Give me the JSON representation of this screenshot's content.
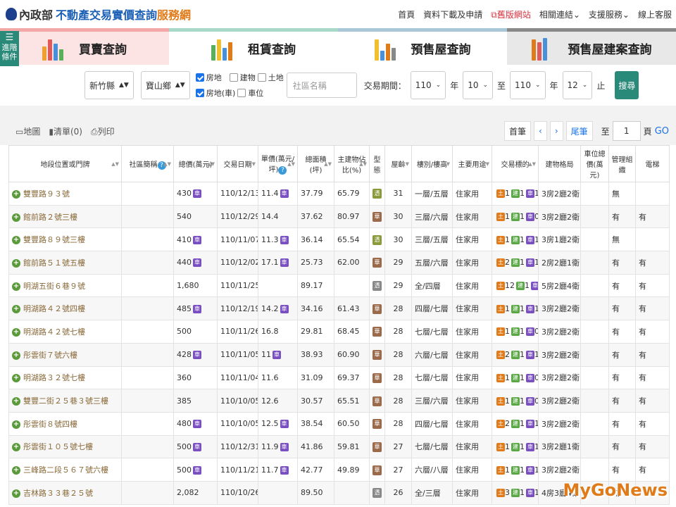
{
  "header": {
    "ministry": "內政部",
    "title_main": "不動產交易實價查詢",
    "title_suffix": "服務網",
    "nav": [
      "首頁",
      "資料下載及申請",
      "舊版網站",
      "相關連結",
      "支援服務",
      "線上客服"
    ]
  },
  "advanced": {
    "label1": "進階",
    "label2": "條件"
  },
  "tabs": [
    {
      "label": "買賣查詢"
    },
    {
      "label": "租賃查詢"
    },
    {
      "label": "預售屋查詢"
    },
    {
      "label": "預售屋建案查詢"
    }
  ],
  "filters": {
    "county": "新竹縣",
    "town": "寶山鄉",
    "types": [
      "房地",
      "建物",
      "土地",
      "房地(車)",
      "車位"
    ],
    "types_checked": [
      true,
      false,
      false,
      true,
      false
    ],
    "community_placeholder": "社區名稱",
    "period_label": "交易期間：",
    "from_year": "110",
    "year_unit": "年",
    "from_month": "10",
    "to_label": "至",
    "to_year": "110",
    "to_month": "12",
    "end_label": "止",
    "search": "搜尋"
  },
  "toolbar": {
    "map": "地圖",
    "list": "清單(0)",
    "print": "列印",
    "first": "首筆",
    "prev": "‹",
    "next": "›",
    "last": "尾筆",
    "to": "至",
    "page": "1",
    "page_unit": "頁",
    "go": "GO"
  },
  "table": {
    "headers": [
      "地段位置或門牌",
      "社區簡稱",
      "總價(萬元)",
      "交易日期",
      "單價(萬元/坪)",
      "總面積(坪)",
      "主建物佔比(%)",
      "型態",
      "屋齡",
      "樓別/樓高",
      "主要用途",
      "交易標的",
      "建物格局",
      "車位總價(萬元)",
      "管理組織",
      "電梯"
    ],
    "rows": [
      {
        "addr": "雙豐路９３號",
        "price": "430",
        "pcar": true,
        "date": "110/12/13",
        "unit": "11.4",
        "ucar": true,
        "area": "37.79",
        "ratio": "65.79",
        "type": "透",
        "tcolor": "#8a9a3a",
        "age": "31",
        "floor": "一層/五層",
        "use": "住家用",
        "t1": "1",
        "t2": "1",
        "t3": "1",
        "layout": "3房2廳2衛",
        "mgmt": "無",
        "elev": ""
      },
      {
        "addr": "館前路２號三樓",
        "price": "540",
        "pcar": false,
        "date": "110/12/29",
        "unit": "14.4",
        "ucar": false,
        "area": "37.62",
        "ratio": "80.97",
        "type": "華",
        "tcolor": "#9a6a4a",
        "age": "30",
        "floor": "三層/六層",
        "use": "住家用",
        "t1": "1",
        "t2": "1",
        "t3": "0",
        "layout": "3房2廳2衛",
        "mgmt": "有",
        "elev": "有"
      },
      {
        "addr": "雙豐路８９號三樓",
        "price": "410",
        "pcar": true,
        "date": "110/11/07",
        "unit": "11.3",
        "ucar": true,
        "area": "36.14",
        "ratio": "65.54",
        "type": "透",
        "tcolor": "#8a9a3a",
        "age": "30",
        "floor": "三層/五層",
        "use": "住家用",
        "t1": "1",
        "t2": "1",
        "t3": "1",
        "layout": "3房1廳2衛",
        "mgmt": "無",
        "elev": ""
      },
      {
        "addr": "館前路５１號五樓",
        "price": "440",
        "pcar": true,
        "date": "110/12/02",
        "unit": "17.1",
        "ucar": true,
        "area": "25.73",
        "ratio": "62.00",
        "type": "華",
        "tcolor": "#9a6a4a",
        "age": "29",
        "floor": "五層/六層",
        "use": "住家用",
        "t1": "2",
        "t2": "1",
        "t3": "1",
        "layout": "2房2廳1衛",
        "mgmt": "有",
        "elev": "有"
      },
      {
        "addr": "明湖五街６巷９號",
        "price": "1,680",
        "pcar": false,
        "date": "110/11/25",
        "unit": "",
        "ucar": false,
        "area": "89.17",
        "ratio": "",
        "type": "透",
        "tcolor": "#888",
        "age": "29",
        "floor": "全/四層",
        "use": "住家用",
        "t1": "12",
        "t2": "1",
        "t3": "0",
        "layout": "5房2廳4衛",
        "mgmt": "有",
        "elev": "有"
      },
      {
        "addr": "明湖路４２號四樓",
        "price": "485",
        "pcar": true,
        "date": "110/12/19",
        "unit": "14.2",
        "ucar": true,
        "area": "34.16",
        "ratio": "61.43",
        "type": "華",
        "tcolor": "#9a6a4a",
        "age": "28",
        "floor": "四層/七層",
        "use": "住家用",
        "t1": "1",
        "t2": "1",
        "t3": "1",
        "layout": "3房2廳2衛",
        "mgmt": "有",
        "elev": "有"
      },
      {
        "addr": "明湖路４２號七樓",
        "price": "500",
        "pcar": false,
        "date": "110/11/26",
        "unit": "16.8",
        "ucar": false,
        "area": "29.81",
        "ratio": "68.45",
        "type": "華",
        "tcolor": "#9a6a4a",
        "age": "28",
        "floor": "七層/七層",
        "use": "住家用",
        "t1": "1",
        "t2": "1",
        "t3": "0",
        "layout": "3房2廳2衛",
        "mgmt": "有",
        "elev": "有"
      },
      {
        "addr": "彤雲街７號六樓",
        "price": "428",
        "pcar": true,
        "date": "110/11/05",
        "unit": "11",
        "ucar": true,
        "area": "38.93",
        "ratio": "60.90",
        "type": "華",
        "tcolor": "#9a6a4a",
        "age": "28",
        "floor": "六層/七層",
        "use": "住家用",
        "t1": "2",
        "t2": "1",
        "t3": "1",
        "layout": "3房2廳2衛",
        "mgmt": "有",
        "elev": "有"
      },
      {
        "addr": "明湖路３２號七樓",
        "price": "360",
        "pcar": false,
        "date": "110/11/04",
        "unit": "11.6",
        "ucar": false,
        "area": "31.09",
        "ratio": "69.37",
        "type": "華",
        "tcolor": "#9a6a4a",
        "age": "28",
        "floor": "七層/七層",
        "use": "住家用",
        "t1": "1",
        "t2": "1",
        "t3": "0",
        "layout": "3房2廳2衛",
        "mgmt": "有",
        "elev": "有"
      },
      {
        "addr": "雙豐二街２５巷３號三樓",
        "price": "385",
        "pcar": false,
        "date": "110/10/05",
        "unit": "12.6",
        "ucar": false,
        "area": "30.57",
        "ratio": "65.51",
        "type": "華",
        "tcolor": "#9a6a4a",
        "age": "28",
        "floor": "三層/六層",
        "use": "住家用",
        "t1": "1",
        "t2": "1",
        "t3": "0",
        "layout": "3房2廳2衛",
        "mgmt": "有",
        "elev": "有"
      },
      {
        "addr": "彤雲街８號四樓",
        "price": "480",
        "pcar": true,
        "date": "110/10/05",
        "unit": "12.5",
        "ucar": true,
        "area": "38.54",
        "ratio": "60.50",
        "type": "華",
        "tcolor": "#9a6a4a",
        "age": "28",
        "floor": "四層/七層",
        "use": "住家用",
        "t1": "2",
        "t2": "1",
        "t3": "1",
        "layout": "3房2廳2衛",
        "mgmt": "有",
        "elev": "有"
      },
      {
        "addr": "彤雲街１０５號七樓",
        "price": "500",
        "pcar": true,
        "date": "110/12/31",
        "unit": "11.9",
        "ucar": true,
        "area": "41.86",
        "ratio": "59.81",
        "type": "華",
        "tcolor": "#9a6a4a",
        "age": "27",
        "floor": "七層/七層",
        "use": "住家用",
        "t1": "1",
        "t2": "1",
        "t3": "1",
        "layout": "3房2廳1衛",
        "mgmt": "有",
        "elev": "有"
      },
      {
        "addr": "三峰路二段５６７號六樓",
        "price": "500",
        "pcar": true,
        "date": "110/11/21",
        "unit": "11.7",
        "ucar": true,
        "area": "42.77",
        "ratio": "49.89",
        "type": "華",
        "tcolor": "#9a6a4a",
        "age": "27",
        "floor": "六層/八層",
        "use": "住家用",
        "t1": "1",
        "t2": "1",
        "t3": "1",
        "layout": "3房2廳2衛",
        "mgmt": "有",
        "elev": "有"
      },
      {
        "addr": "吉林路３３巷２５號",
        "price": "2,082",
        "pcar": false,
        "date": "110/10/26",
        "unit": "",
        "ucar": false,
        "area": "89.50",
        "ratio": "",
        "type": "透",
        "tcolor": "#888",
        "age": "26",
        "floor": "全/三層",
        "use": "住家用",
        "t1": "3",
        "t2": "1",
        "t3": "1",
        "layout": "4房3廳4衛",
        "mgmt": "無",
        "elev": ""
      }
    ]
  },
  "badges": {
    "car": "車",
    "land": "土",
    "build": "建",
    "park": "車"
  },
  "watermark": "MyGoNews"
}
